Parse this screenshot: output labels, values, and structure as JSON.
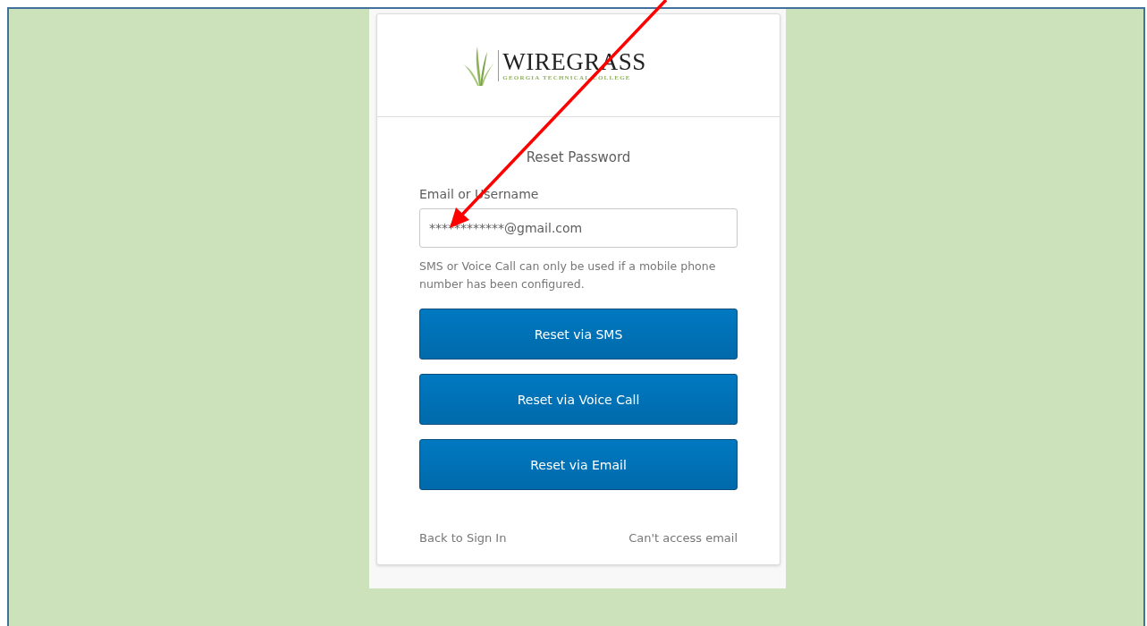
{
  "logo": {
    "name": "WIREGRASS",
    "tagline": "GEORGIA TECHNICAL COLLEGE"
  },
  "form": {
    "title": "Reset Password",
    "field_label": "Email or Username",
    "field_value": "************@gmail.com",
    "hint": "SMS or Voice Call can only be used if a mobile phone number has been configured.",
    "buttons": [
      "Reset via SMS",
      "Reset via Voice Call",
      "Reset via Email"
    ],
    "links": [
      "Back to Sign In",
      "Can't access email"
    ]
  }
}
